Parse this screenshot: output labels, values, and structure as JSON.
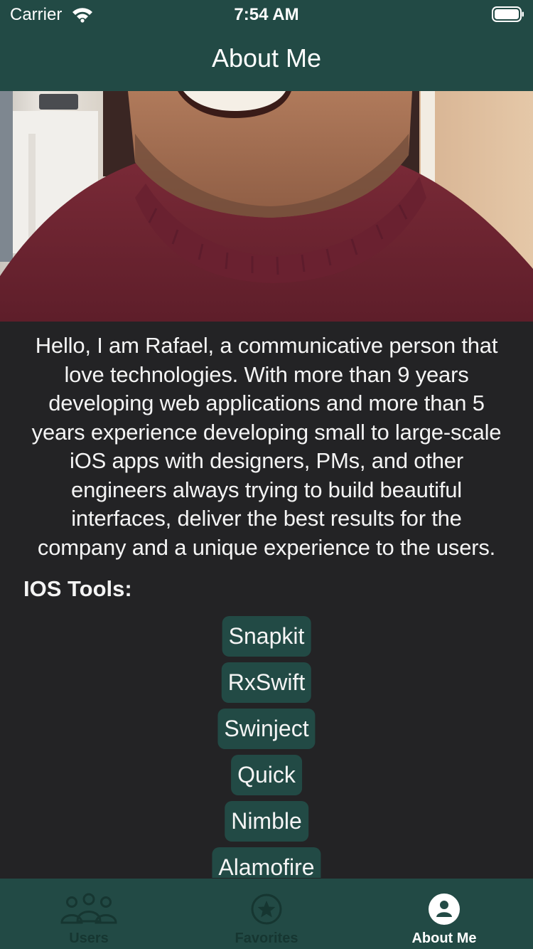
{
  "status_bar": {
    "carrier": "Carrier",
    "time": "7:54 AM",
    "icons": [
      "wifi-icon",
      "battery-icon"
    ]
  },
  "nav": {
    "title": "About Me"
  },
  "profile": {
    "photo": "profile-photo",
    "bio_lines": [
      "Hello, I am Rafael, a communicative person that",
      "love technologies. With more than 9 years",
      "developing web applications and more than 5",
      "years experience developing small to large-scale",
      "iOS apps with designers, PMs, and other",
      "engineers always trying to build beautiful",
      "interfaces, deliver the best results for the",
      "company and a unique experience to the users."
    ]
  },
  "tools": {
    "title": "IOS Tools:",
    "items": [
      "Snapkit",
      "RxSwift",
      "Swinject",
      "Quick",
      "Nimble",
      "Alamofire"
    ]
  },
  "tab_bar": {
    "items": [
      {
        "label": "Users",
        "icon": "users-icon",
        "selected": false
      },
      {
        "label": "Favorites",
        "icon": "star-icon",
        "selected": false
      },
      {
        "label": "About Me",
        "icon": "person-icon",
        "selected": true
      }
    ]
  },
  "colors": {
    "bar": "#224a45",
    "background": "#232325",
    "chip": "#224a45",
    "text": "#f4f4f4",
    "tab_inactive": "#163631",
    "tab_active": "#ffffff"
  }
}
